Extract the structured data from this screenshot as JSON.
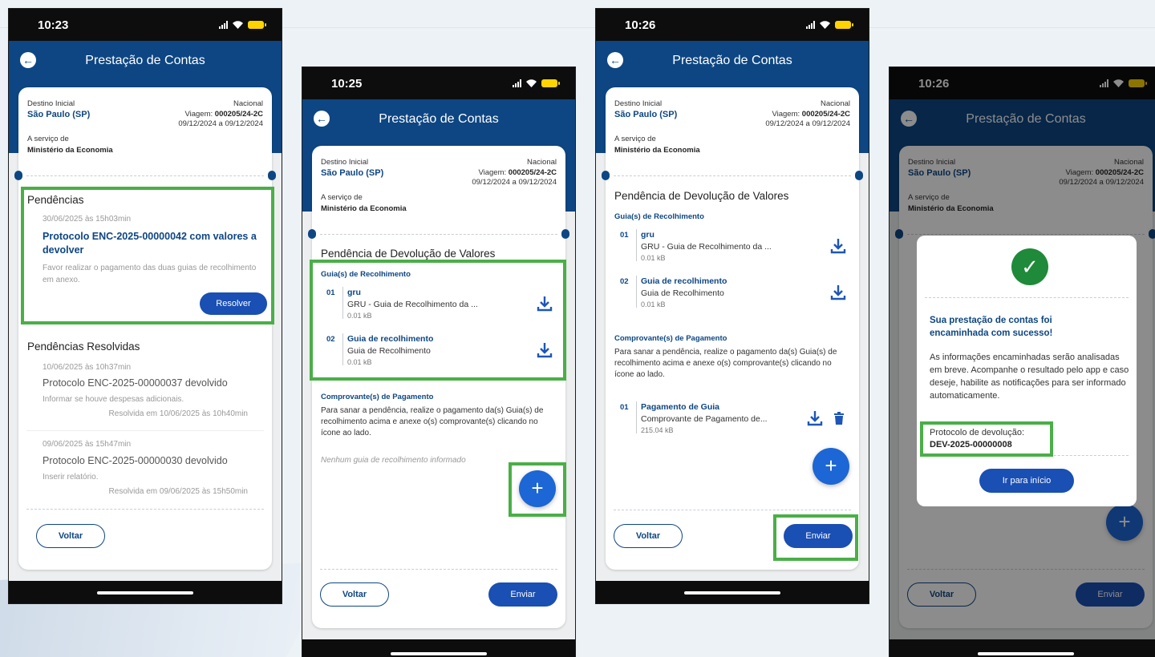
{
  "common": {
    "header_title": "Prestação de Contas",
    "trip": {
      "destino_label": "Destino Inicial",
      "destino_value": "São Paulo (SP)",
      "tipo": "Nacional",
      "viagem_label": "Viagem:",
      "viagem_value": "000205/24-2C",
      "datas": "09/12/2024 a 09/12/2024",
      "servico_label": "A serviço de",
      "servico_value": "Ministério da Economia"
    },
    "btn_voltar": "Voltar",
    "btn_enviar": "Enviar",
    "fab_label": "+"
  },
  "screen1": {
    "time": "10:23",
    "pendencias_title": "Pendências",
    "pendencia": {
      "date": "30/06/2025 às 15h03min",
      "title": "Protocolo ENC-2025-00000042 com valores a devolver",
      "message": "Favor realizar o pagamento das duas guias de recolhimento em anexo.",
      "button": "Resolver"
    },
    "resolvidas_title": "Pendências Resolvidas",
    "resolvidas": [
      {
        "date": "10/06/2025 às 10h37min",
        "title": "Protocolo ENC-2025-00000037 devolvido",
        "note": "Informar se houve despesas adicionais.",
        "resolved": "Resolvida em 10/06/2025 às 10h40min"
      },
      {
        "date": "09/06/2025 às 15h47min",
        "title": "Protocolo ENC-2025-00000030 devolvido",
        "note": "Inserir relatório.",
        "resolved": "Resolvida em 09/06/2025 às 15h50min"
      }
    ]
  },
  "screen2": {
    "time": "10:25",
    "section_title": "Pendência de Devolução de Valores",
    "guias_label": "Guia(s) de Recolhimento",
    "guias": [
      {
        "num": "01",
        "name": "gru",
        "desc": "GRU - Guia de Recolhimento da ...",
        "size": "0.01 kB"
      },
      {
        "num": "02",
        "name": "Guia de recolhimento",
        "desc": "Guia de Recolhimento",
        "size": "0.01 kB"
      }
    ],
    "comprovantes_label": "Comprovante(s) de Pagamento",
    "instructions": "Para sanar a pendência, realize o pagamento da(s) Guia(s) de recolhimento acima e anexe o(s) comprovante(s) clicando no ícone ao lado.",
    "empty_text": "Nenhum guia de recolhimento informado"
  },
  "screen3": {
    "time": "10:26",
    "section_title": "Pendência de Devolução de Valores",
    "guias_label": "Guia(s) de Recolhimento",
    "guias": [
      {
        "num": "01",
        "name": "gru",
        "desc": "GRU - Guia de Recolhimento da ...",
        "size": "0.01 kB"
      },
      {
        "num": "02",
        "name": "Guia de recolhimento",
        "desc": "Guia de Recolhimento",
        "size": "0.01 kB"
      }
    ],
    "comprovantes_label": "Comprovante(s) de Pagamento",
    "instructions": "Para sanar a pendência, realize o pagamento da(s) Guia(s) de recolhimento acima e anexe o(s) comprovante(s) clicando no ícone ao lado.",
    "comprovante": {
      "num": "01",
      "name": "Pagamento de Guia",
      "desc": "Comprovante de Pagamento de...",
      "size": "215.04 kB"
    }
  },
  "screen4": {
    "time": "10:26",
    "modal": {
      "title": "Sua prestação de contas foi encaminhada com sucesso!",
      "body": "As informações encaminhadas serão analisadas em breve. Acompanhe o resultado pelo app e caso deseje, habilite as notificações para ser informado automaticamente.",
      "protocolo_label": "Protocolo de devolução:",
      "protocolo_value": "DEV-2025-00000008",
      "button": "Ir para início"
    }
  },
  "colors": {
    "header_blue": "#0d4683",
    "highlight_green": "#4aaf47",
    "fab_blue": "#1c66d6",
    "success_green": "#1f8a3a"
  }
}
